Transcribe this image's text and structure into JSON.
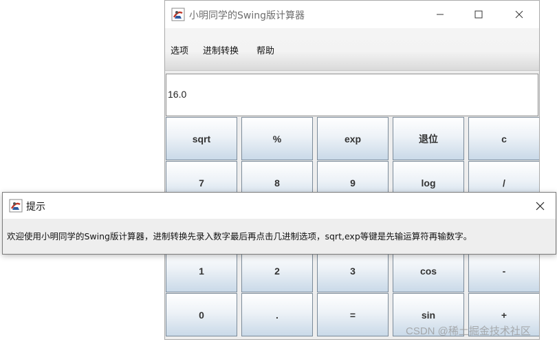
{
  "window": {
    "title": "小明同学的Swing版计算器",
    "icon": "java-cup-icon"
  },
  "menu": {
    "items": [
      "选项",
      "进制转换",
      "帮助"
    ]
  },
  "display": {
    "value": "16.0"
  },
  "keys": {
    "row1": [
      "sqrt",
      "%",
      "exp",
      "退位",
      "c"
    ],
    "row2": [
      "7",
      "8",
      "9",
      "log",
      "/"
    ],
    "row4": [
      "1",
      "2",
      "3",
      "cos",
      "-"
    ],
    "row5": [
      "0",
      ".",
      "=",
      "sin",
      "+"
    ]
  },
  "dialog": {
    "title": "提示",
    "message": "欢迎使用小明同学的Swing版计算器，进制转换先录入数字最后再点击几进制选项，sqrt,exp等键是先输运算符再输数字。"
  },
  "watermark": "CSDN @稀土掘金技术社区"
}
